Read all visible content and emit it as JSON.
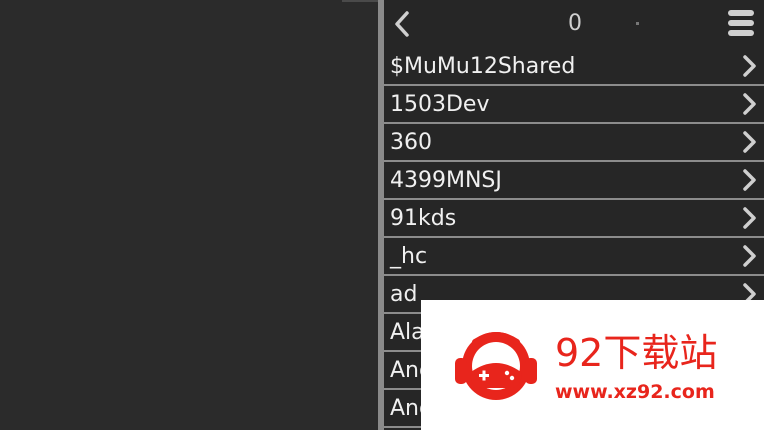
{
  "header": {
    "back_icon": "chevron-left-icon",
    "count": "0",
    "menu_icon": "menu-icon"
  },
  "list": {
    "items": [
      {
        "label": "$MuMu12Shared"
      },
      {
        "label": "1503Dev"
      },
      {
        "label": "360"
      },
      {
        "label": "4399MNSJ"
      },
      {
        "label": "91kds"
      },
      {
        "label": "_hc"
      },
      {
        "label": "ad"
      },
      {
        "label": "Ala"
      },
      {
        "label": "And"
      },
      {
        "label": "And"
      }
    ],
    "chevron_icon": "chevron-right-icon"
  },
  "watermark": {
    "title": "92下载站",
    "url": "www.xz92.com",
    "logo_icon": "gamepad-mascot-logo",
    "color": "#e8251c"
  },
  "colors": {
    "background": "#2b2b2b",
    "list_background": "#262626",
    "divider": "#8a8a8a",
    "row_separator": "#8c8c8c",
    "text": "#f0f0f0"
  }
}
